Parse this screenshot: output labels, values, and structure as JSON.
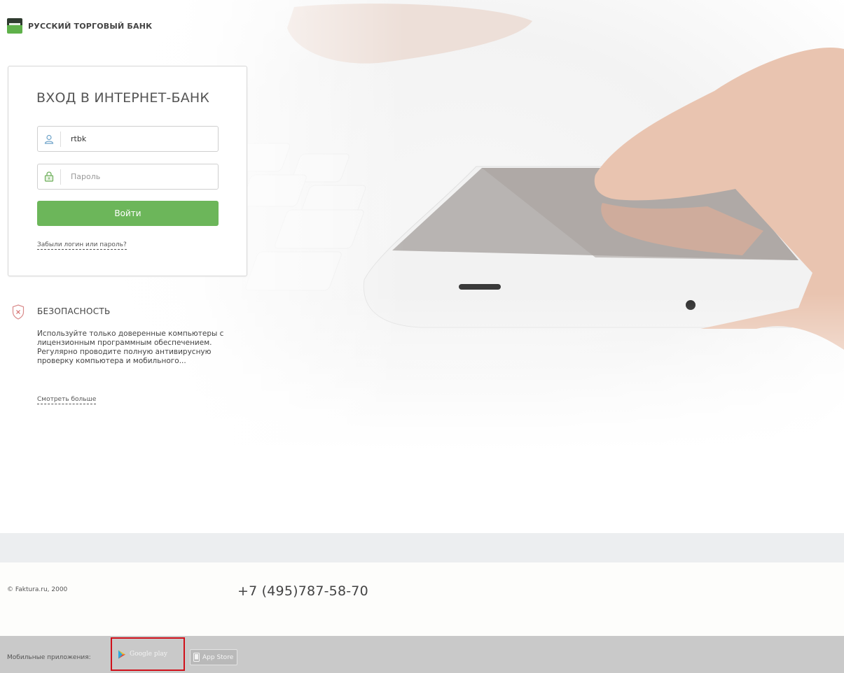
{
  "brand": {
    "name": "РУССКИЙ ТОРГОВЫЙ БАНК"
  },
  "login": {
    "title": "ВХОД В ИНТЕРНЕТ-БАНК",
    "login_value": "rtbk",
    "password_placeholder": "Пароль",
    "submit_label": "Войти",
    "forgot_link": "Забыли логин или пароль?"
  },
  "security": {
    "title": "БЕЗОПАСНОСТЬ",
    "text": "Используйте только доверенные компьютеры с лицензионным программным обеспечением. Регулярно проводите полную антивирусную проверку компьютера и мобильного...",
    "more_link": "Смотреть больше"
  },
  "footer": {
    "copyright": "© Faktura.ru, 2000",
    "phone": "+7 (495)787-58-70",
    "apps_label": "Мобильные приложения:",
    "google_play": "Google play",
    "app_store": "App Store"
  },
  "icons": {
    "logo": "bank-logo-icon",
    "user": "user-icon",
    "lock": "lock-icon",
    "shield": "shield-icon",
    "play": "google-play-icon",
    "phone": "phone-icon"
  },
  "colors": {
    "accent_green": "#6cb65a",
    "highlight_red": "#d0101a",
    "footer_gray": "#c9c9c9"
  }
}
